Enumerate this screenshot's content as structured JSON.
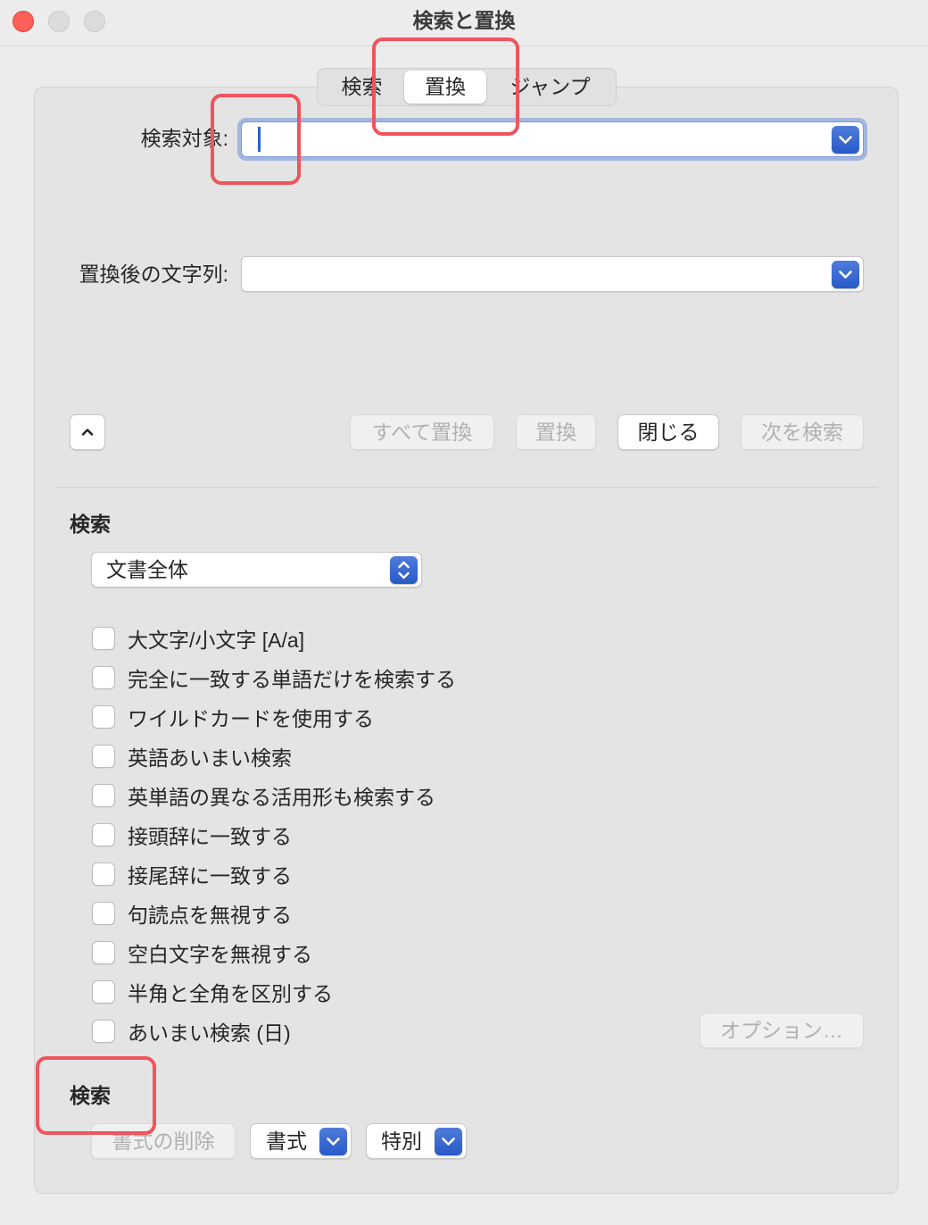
{
  "window": {
    "title": "検索と置換"
  },
  "tabs": [
    {
      "label": "検索",
      "selected": false
    },
    {
      "label": "置換",
      "selected": true
    },
    {
      "label": "ジャンプ",
      "selected": false
    }
  ],
  "find": {
    "label": "検索対象:",
    "value": ""
  },
  "replace": {
    "label": "置換後の文字列:",
    "value": ""
  },
  "actions": {
    "replace_all": {
      "label": "すべて置換",
      "enabled": false
    },
    "replace": {
      "label": "置換",
      "enabled": false
    },
    "close": {
      "label": "閉じる",
      "enabled": true
    },
    "find_next": {
      "label": "次を検索",
      "enabled": false
    }
  },
  "search_options": {
    "heading": "検索",
    "scope": "文書全体",
    "checkboxes": [
      {
        "label": "大文字/小文字 [A/a]",
        "checked": false
      },
      {
        "label": "完全に一致する単語だけを検索する",
        "checked": false
      },
      {
        "label": "ワイルドカードを使用する",
        "checked": false
      },
      {
        "label": "英語あいまい検索",
        "checked": false
      },
      {
        "label": "英単語の異なる活用形も検索する",
        "checked": false
      },
      {
        "label": "接頭辞に一致する",
        "checked": false
      },
      {
        "label": "接尾辞に一致する",
        "checked": false
      },
      {
        "label": "句読点を無視する",
        "checked": false
      },
      {
        "label": "空白文字を無視する",
        "checked": false
      },
      {
        "label": "半角と全角を区別する",
        "checked": false
      },
      {
        "label": "あいまい検索 (日)",
        "checked": false
      }
    ],
    "options_button": {
      "label": "オプション…",
      "enabled": false
    }
  },
  "format_section": {
    "heading": "検索",
    "clear_format": {
      "label": "書式の削除",
      "enabled": false
    },
    "format": {
      "label": "書式"
    },
    "special": {
      "label": "特別"
    }
  },
  "colors": {
    "window_bg": "#ececec",
    "panel_bg": "#e4e4e4",
    "accent": "#2a5fd3",
    "focus_ring": "#7c9be0",
    "close_light": "#fe5f57",
    "inactive_light": "#dcdcdc",
    "text": "#262626",
    "disabled_text": "#b1b1b1",
    "annotation": "#f0545c"
  }
}
